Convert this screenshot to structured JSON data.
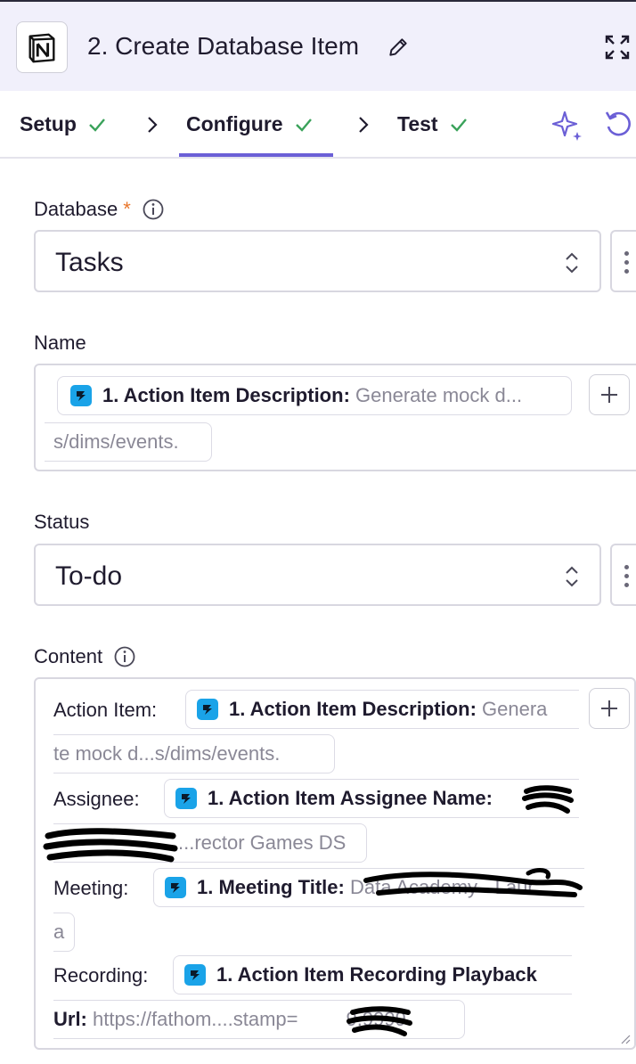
{
  "header": {
    "title": "2. Create Database Item",
    "icons": {
      "app": "notion-logo-icon",
      "edit": "pencil-icon",
      "expand": "expand-icon"
    }
  },
  "tabs": [
    {
      "label": "Setup",
      "status": "complete"
    },
    {
      "label": "Configure",
      "status": "complete",
      "active": true
    },
    {
      "label": "Test",
      "status": "complete"
    }
  ],
  "toolbar": {
    "icons": [
      "sparkle-icon",
      "undo-icon"
    ]
  },
  "colors": {
    "accent": "#6b5fd6",
    "check": "#3aa25a",
    "required": "#e9762b",
    "app_badge": "#1aa3e8"
  },
  "fields": {
    "database": {
      "label": "Database",
      "required_mark": "*",
      "value": "Tasks"
    },
    "name": {
      "label": "Name",
      "pill_label": "1. Action Item Description:",
      "pill_value": "Generate mock d...",
      "pill_value_cont": "s/dims/events."
    },
    "status": {
      "label": "Status",
      "value": "To-do"
    },
    "content": {
      "label": "Content",
      "lines": [
        {
          "prefix": "Action Item:",
          "pill_label": "1. Action Item Description:",
          "pill_value": "Genera",
          "cont": "te mock d...s/dims/events."
        },
        {
          "prefix": "Assignee:",
          "pill_label": "1. Action Item Assignee Name:",
          "pill_value": "",
          "cont": "...rector Games DS"
        },
        {
          "prefix": "Meeting:",
          "pill_label": "1. Meeting Title:",
          "pill_value": "Data Academy - Laur",
          "cont": "a"
        },
        {
          "prefix": "Recording:",
          "pill_label": "1. Action Item Recording Playback",
          "cont_label": "Url:",
          "cont_value": "https://fathom....stamp=",
          "cont_value_end": "9.9999"
        }
      ]
    }
  }
}
